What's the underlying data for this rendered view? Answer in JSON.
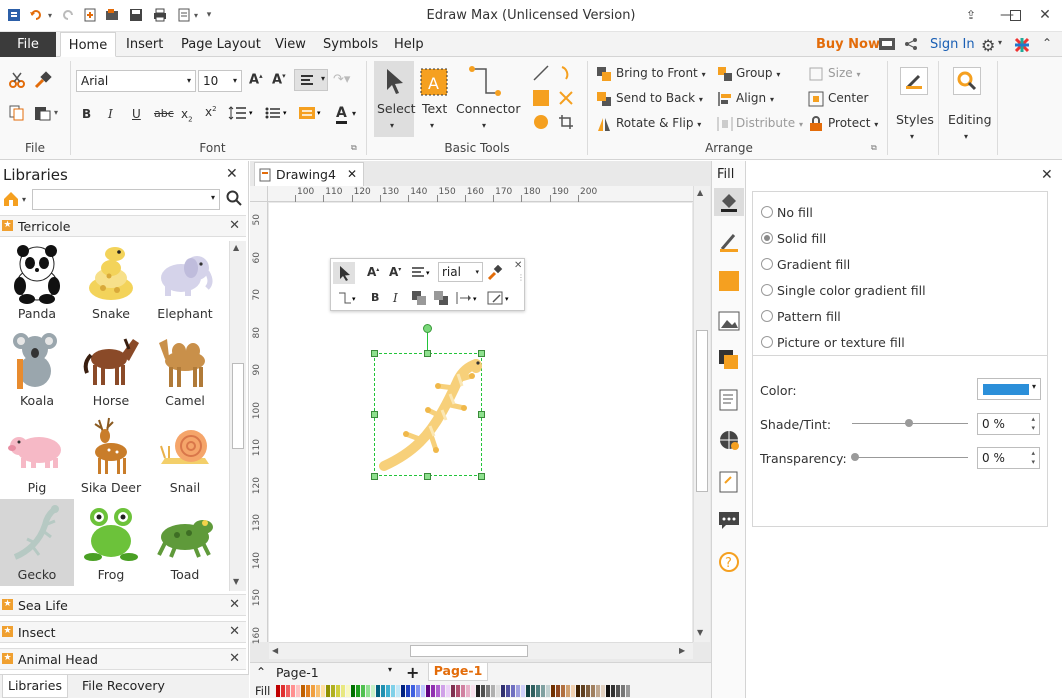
{
  "app": {
    "title": "Edraw Max (Unlicensed Version)"
  },
  "tabs": [
    "File",
    "Home",
    "Insert",
    "Page Layout",
    "View",
    "Symbols",
    "Help"
  ],
  "account": {
    "buy_now": "Buy Now",
    "sign_in": "Sign In"
  },
  "ribbon": {
    "groups": {
      "file": "File",
      "font": "Font",
      "basic_tools": "Basic Tools",
      "arrange": "Arrange"
    },
    "font_name": "Arial",
    "font_size": "10",
    "tools": {
      "select": "Select",
      "text": "Text",
      "connector": "Connector"
    },
    "arrange": {
      "bring_to_front": "Bring to Front",
      "send_to_back": "Send to Back",
      "rotate_flip": "Rotate & Flip",
      "group": "Group",
      "align": "Align",
      "distribute": "Distribute",
      "size": "Size",
      "center": "Center",
      "protect": "Protect"
    },
    "styles": "Styles",
    "editing": "Editing"
  },
  "libraries": {
    "title": "Libraries",
    "search_placeholder": "",
    "open_library": "Terricole",
    "items": [
      {
        "name": "Panda"
      },
      {
        "name": "Snake"
      },
      {
        "name": "Elephant"
      },
      {
        "name": "Koala"
      },
      {
        "name": "Horse"
      },
      {
        "name": "Camel"
      },
      {
        "name": "Pig"
      },
      {
        "name": "Sika Deer"
      },
      {
        "name": "Snail"
      },
      {
        "name": "Gecko"
      },
      {
        "name": "Frog"
      },
      {
        "name": "Toad"
      }
    ],
    "collapsed": [
      "Sea Life",
      "Insect",
      "Animal Head"
    ],
    "bottom_tabs": [
      "Libraries",
      "File Recovery"
    ]
  },
  "document": {
    "tab": "Drawing4",
    "ruler_h": [
      "100",
      "110",
      "120",
      "130",
      "140",
      "150",
      "160",
      "170",
      "180",
      "190",
      "200"
    ],
    "ruler_v": [
      "50",
      "60",
      "70",
      "80",
      "90",
      "100",
      "110",
      "120",
      "130",
      "140",
      "150",
      "160"
    ],
    "mini_toolbar": {
      "font": "rial"
    },
    "page_select": "Page-1",
    "page_tab": "Page-1",
    "fill_label": "Fill"
  },
  "fill_panel": {
    "title": "Fill",
    "options": [
      "No fill",
      "Solid fill",
      "Gradient fill",
      "Single color gradient fill",
      "Pattern fill",
      "Picture or texture fill"
    ],
    "selected": "Solid fill",
    "color_label": "Color:",
    "color_value": "#2b8fd9",
    "shade_label": "Shade/Tint:",
    "shade_value": "0 %",
    "transparency_label": "Transparency:",
    "transparency_value": "0 %"
  },
  "colors": {
    "accent": "#e36c0a",
    "orange_icon": "#f5a020",
    "selection": "#22c43a",
    "gecko": "#f7d07a"
  }
}
